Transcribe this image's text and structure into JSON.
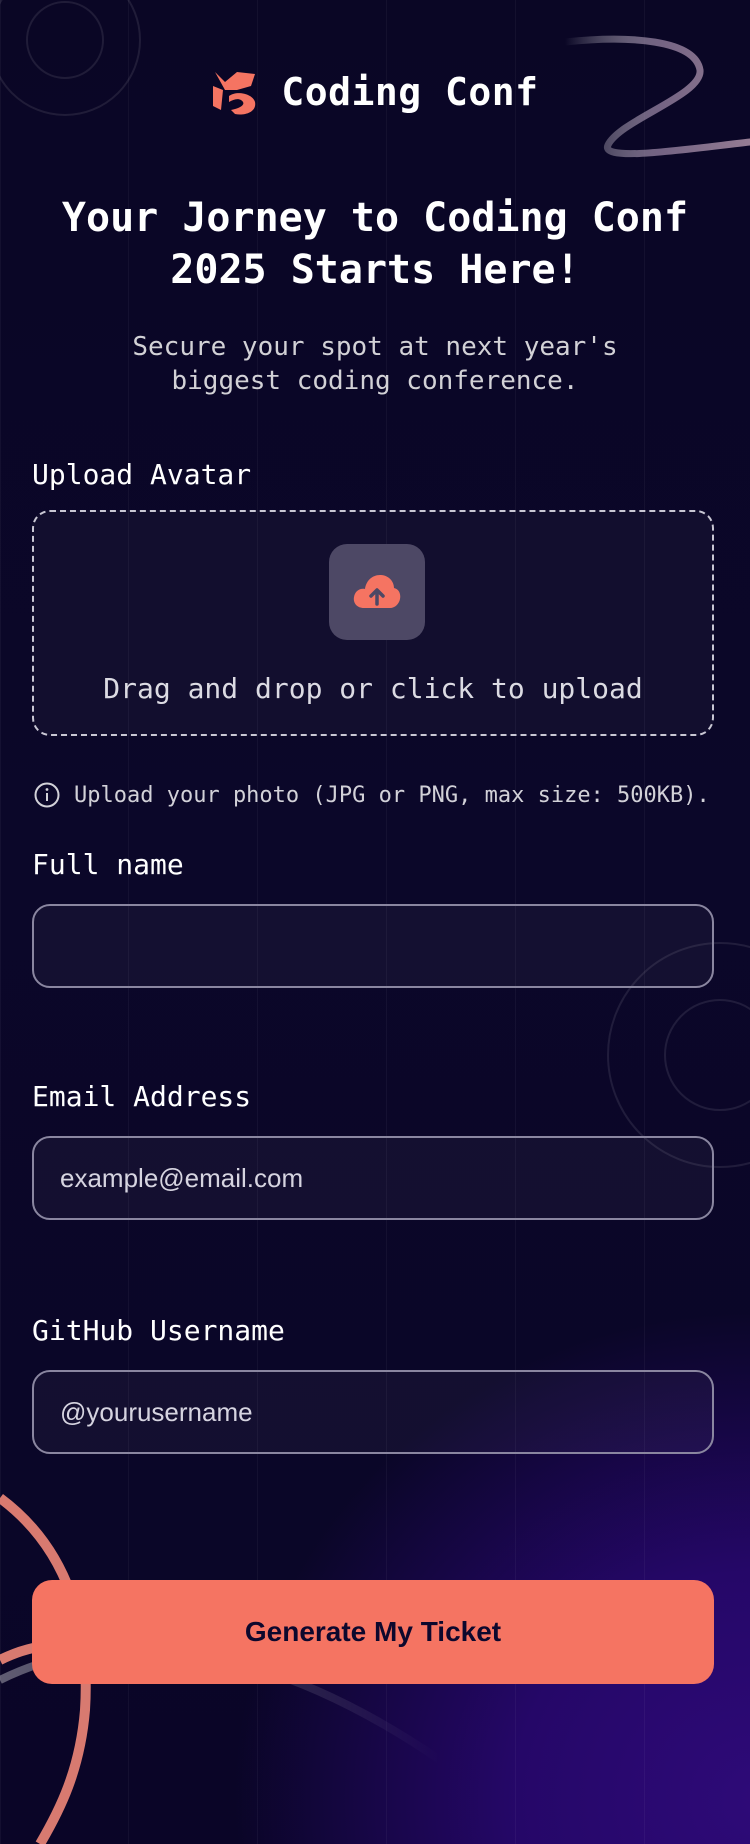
{
  "app": {
    "name": "Coding Conf"
  },
  "hero": {
    "title": "Your Jorney to Coding Conf 2025 Starts Here!",
    "subtitle": "Secure your spot at next year's biggest coding conference."
  },
  "form": {
    "avatar": {
      "label": "Upload Avatar",
      "dropzone_text": "Drag and drop or click to upload",
      "hint": "Upload your photo (JPG or PNG, max size: 500KB).",
      "icon": "cloud-upload-icon"
    },
    "full_name": {
      "label": "Full name",
      "value": "",
      "placeholder": ""
    },
    "email": {
      "label": "Email Address",
      "value": "",
      "placeholder": "example@email.com"
    },
    "github": {
      "label": "GitHub Username",
      "value": "",
      "placeholder": "@yourusername"
    },
    "submit_label": "Generate My Ticket"
  },
  "colors": {
    "accent": "#f57462",
    "background": "#0a0625",
    "button_text": "#0d082d",
    "upload_box": "#4d4865"
  }
}
